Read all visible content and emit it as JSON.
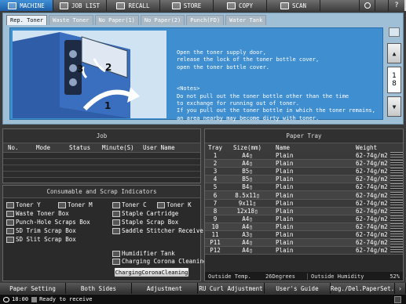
{
  "nav": {
    "tabs": [
      {
        "label": "MACHINE",
        "active": true
      },
      {
        "label": "JOB LIST"
      },
      {
        "label": "RECALL"
      },
      {
        "label": "STORE"
      },
      {
        "label": "COPY"
      },
      {
        "label": "SCAN"
      }
    ],
    "help": "?"
  },
  "subtabs": [
    "Rep. Toner",
    "Waste Toner",
    "No Paper(1)",
    "No Paper(2)",
    "Punch(FD)",
    "Water Tank"
  ],
  "message": "Open the toner supply door,\nrelease the lock of the toner bottle cover,\nopen the toner bottle cover.\n\n\n<Notes>\nDo not pull out the toner bottle other than the time\nto exchange for running out of toner.\nIf you pull out the toner bottle in which the toner remains,\nan area nearby may become dirty with toner.",
  "steps": {
    "one": "1",
    "two": "2",
    "three": "3"
  },
  "pager": {
    "current": "1",
    "total": "8"
  },
  "job": {
    "title": "Job",
    "cols": [
      "No.",
      "Mode",
      "Status",
      "Minute(S)",
      "User Name"
    ]
  },
  "consumables": {
    "title": "Consumable and Scrap Indicators",
    "items": {
      "tony": "Toner Y",
      "tonm": "Toner M",
      "tonc": "Toner C",
      "tonk": "Toner K",
      "waste": "Waste Toner Box",
      "staple": "Staple Cartridge",
      "punch": "Punch-Hole Scraps Box",
      "staplescrap": "Staple Scrap Box",
      "sdtrim": "SD Trim Scrap Box",
      "saddle": "Saddle Stitcher Receiver",
      "sdslit": "SD Slit Scrap Box",
      "humid": "Humidifier Tank",
      "corona": "Charging Corona Cleaning"
    },
    "button": "ChargingCoronaCleaning"
  },
  "tray": {
    "title": "Paper Tray",
    "cols": [
      "Tray",
      "Size(mm)",
      "Name",
      "Weight"
    ],
    "rows": [
      [
        "1",
        "A4▯",
        "Plain",
        "62-74g/m2"
      ],
      [
        "2",
        "A4▯",
        "Plain",
        "62-74g/m2"
      ],
      [
        "3",
        "B5▯",
        "Plain",
        "62-74g/m2"
      ],
      [
        "4",
        "B5▯",
        "Plain",
        "62-74g/m2"
      ],
      [
        "5",
        "B4▯",
        "Plain",
        "62-74g/m2"
      ],
      [
        "6",
        "8.5x11▯",
        "Plain",
        "62-74g/m2"
      ],
      [
        "7",
        "9x11▯",
        "Plain",
        "62-74g/m2"
      ],
      [
        "8",
        "12x18▯",
        "Plain",
        "62-74g/m2"
      ],
      [
        "9",
        "A4▯",
        "Plain",
        "62-74g/m2"
      ],
      [
        "10",
        "A4▯",
        "Plain",
        "62-74g/m2"
      ],
      [
        "11",
        "A3▯",
        "Plain",
        "62-74g/m2"
      ],
      [
        "P11",
        "A4▯",
        "Plain",
        "62-74g/m2"
      ],
      [
        "P12",
        "A4▯",
        "Plain",
        "62-74g/m2"
      ]
    ],
    "outside_temp_label": "Outside Temp.",
    "outside_temp": "26Degrees",
    "outside_hum_label": "Outside Humidity",
    "outside_hum": "52%"
  },
  "bottom": [
    "Paper Setting",
    "Both Sides",
    "Adjustment",
    "RU Curl Adjustment",
    "User's Guide",
    "Reg./Del.PaperSet."
  ],
  "status": {
    "time": "18:00",
    "text": "Ready to receive"
  },
  "colors": {
    "accent": "#3f8ed0",
    "panel": "#9fbfd6"
  }
}
